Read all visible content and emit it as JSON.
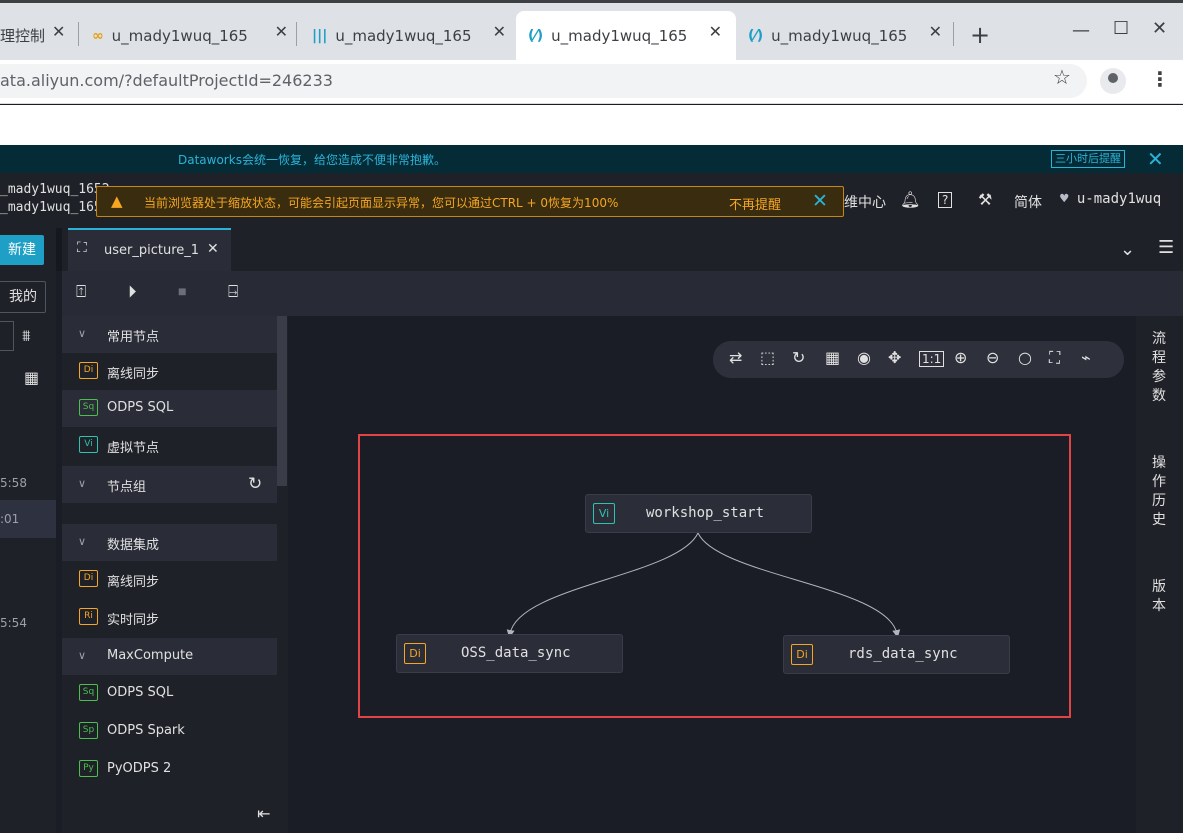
{
  "browser": {
    "tabs": [
      {
        "label": "理控制",
        "icon": ""
      },
      {
        "label": "u_mady1wuq_165",
        "icon": "∞"
      },
      {
        "label": "u_mady1wuq_165",
        "icon": "|||"
      },
      {
        "label": "u_mady1wuq_165",
        "icon": "(⁄)"
      },
      {
        "label": "u_mady1wuq_165",
        "icon": "(⁄)"
      }
    ],
    "url": "ata.aliyun.com/?defaultProjectId=246233"
  },
  "notice": {
    "text": "Dataworks会统一恢复，给您造成不便非常抱歉。",
    "button": "三小时后提醒"
  },
  "header": {
    "project_line1": "_mady1wuq_1652",
    "project_line2": "_mady1wuq_165",
    "warning": "当前浏览器处于缩放状态，可能会引起页面显示异常，您可以通过CTRL + 0恢复为100%",
    "warning_dismiss": "不再提醒",
    "ops_center": "维中心",
    "lang": "简体",
    "user": "u-mady1wuq"
  },
  "left": {
    "new_button": "新建",
    "mine_select": "我的",
    "times": [
      "5:58",
      ":01",
      "5:54"
    ]
  },
  "editor": {
    "tab_label": "user_picture_1"
  },
  "node_panel": {
    "groups": [
      {
        "title": "常用节点",
        "items": [
          {
            "badge": "Di",
            "label": "离线同步",
            "color": "#f5a623"
          },
          {
            "badge": "Sq",
            "label": "ODPS SQL",
            "color": "#4cbf4c"
          },
          {
            "badge": "Vi",
            "label": "虚拟节点",
            "color": "#2fc2b0"
          }
        ]
      },
      {
        "title": "节点组"
      },
      {
        "title": "数据集成",
        "items": [
          {
            "badge": "Di",
            "label": "离线同步",
            "color": "#f5a623"
          },
          {
            "badge": "Ri",
            "label": "实时同步",
            "color": "#f5a623"
          }
        ]
      },
      {
        "title": "MaxCompute",
        "items": [
          {
            "badge": "Sq",
            "label": "ODPS SQL",
            "color": "#4cbf4c"
          },
          {
            "badge": "Sp",
            "label": "ODPS Spark",
            "color": "#4cbf4c"
          },
          {
            "badge": "Py",
            "label": "PyODPS 2",
            "color": "#4cbf4c"
          }
        ]
      }
    ]
  },
  "graph": {
    "nodes": [
      {
        "badge": "Vi",
        "label": "workshop_start",
        "color": "#2fc2b0"
      },
      {
        "badge": "Di",
        "label": "OSS_data_sync",
        "color": "#f5a623"
      },
      {
        "badge": "Di",
        "label": "rds_data_sync",
        "color": "#f5a623"
      }
    ]
  },
  "right_rail": {
    "items": [
      "流程参数",
      "操作历史",
      "版本"
    ]
  },
  "colors": {
    "accent": "#2bb3d7",
    "warning": "#f5a623",
    "highlight": "#e04445"
  }
}
